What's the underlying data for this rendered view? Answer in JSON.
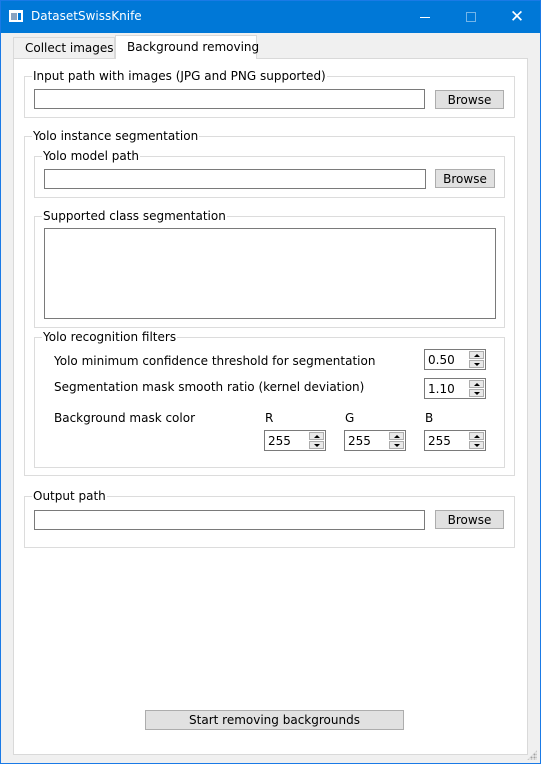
{
  "window": {
    "title": "DatasetSwissKnife",
    "accent_color": "#0078d7"
  },
  "tabs": [
    {
      "label": "Collect images",
      "selected": false
    },
    {
      "label": "Background removing",
      "selected": true
    }
  ],
  "input_group": {
    "legend": "Input path with images (JPG and PNG supported)",
    "path_value": "",
    "browse_label": "Browse"
  },
  "yolo_group": {
    "legend": "Yolo instance segmentation",
    "model_path": {
      "legend": "Yolo model path",
      "value": "",
      "browse_label": "Browse"
    },
    "supported_classes": {
      "legend": "Supported class segmentation",
      "items": []
    },
    "filters": {
      "legend": "Yolo recognition filters",
      "confidence_label": "Yolo minimum confidence threshold for segmentation",
      "confidence_value": "0.50",
      "smooth_label": "Segmentation mask smooth ratio (kernel deviation)",
      "smooth_value": "1.10",
      "mask_color_label": "Background mask color",
      "r_label": "R",
      "g_label": "G",
      "b_label": "B",
      "r_value": "255",
      "g_value": "255",
      "b_value": "255"
    }
  },
  "output_group": {
    "legend": "Output path",
    "value": "",
    "browse_label": "Browse"
  },
  "start_button_label": "Start removing backgrounds",
  "icons": [
    "app-icon",
    "minimize-icon",
    "maximize-icon",
    "close-icon",
    "spin-up-icon",
    "spin-down-icon",
    "resize-grip-icon"
  ]
}
